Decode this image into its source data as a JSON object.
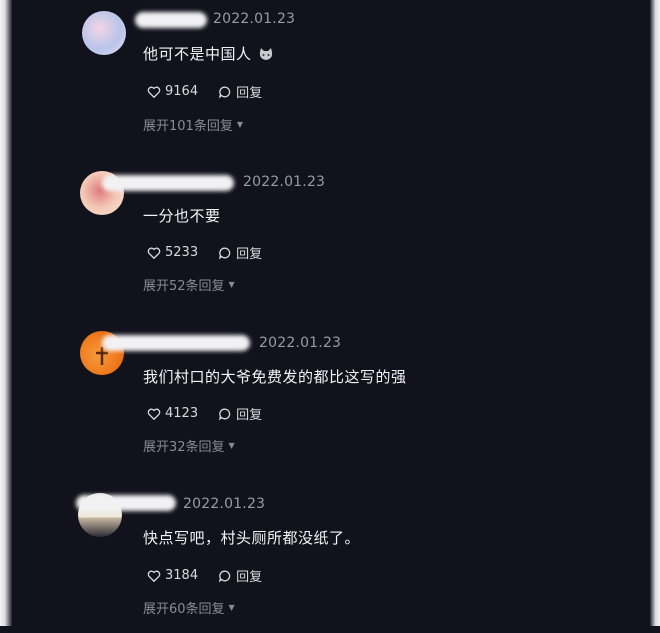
{
  "comments": [
    {
      "date": "2022.01.23",
      "text": "他可不是中国人",
      "emoji": "cat-face",
      "likes": "9164",
      "reply_label": "回复",
      "expand_label": "展开101条回复",
      "avatar_colors": [
        "#e7e3f2",
        "#b9c4ea",
        "#f2d6e6"
      ]
    },
    {
      "date": "2022.01.23",
      "text": "一分也不要",
      "likes": "5233",
      "reply_label": "回复",
      "expand_label": "展开52条回复",
      "avatar_colors": [
        "#f3c9b6",
        "#e07a7e",
        "#f6e3d6"
      ]
    },
    {
      "date": "2022.01.23",
      "text": "我们村口的大爷免费发的都比这写的强",
      "likes": "4123",
      "reply_label": "回复",
      "expand_label": "展开32条回复",
      "avatar_colors": [
        "#ef7a1c",
        "#f59a3c",
        "#7a3b10"
      ]
    },
    {
      "date": "2022.01.23",
      "text": "快点写吧，村头厕所都没纸了。",
      "likes": "3184",
      "reply_label": "回复",
      "expand_label": "展开60条回复",
      "avatar_colors": [
        "#efe8de",
        "#c9b8a4",
        "#2b2b33"
      ]
    }
  ],
  "icons": {
    "like": "heart-outline",
    "reply": "speech-bubble-outline",
    "expand": "caret-down"
  }
}
